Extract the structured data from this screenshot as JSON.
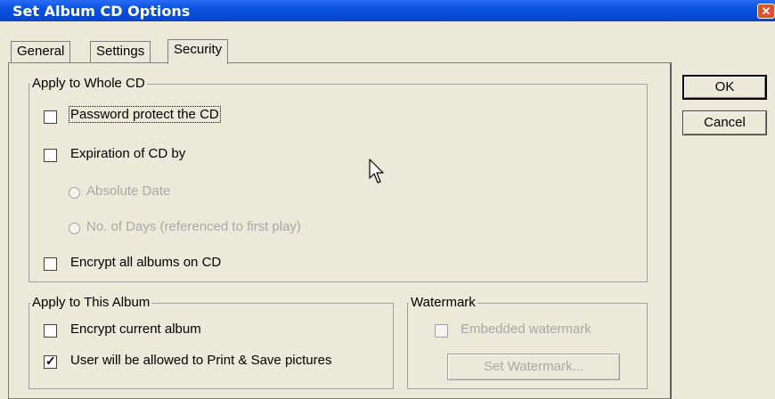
{
  "window": {
    "title": "Set Album CD Options",
    "close_label": "✕"
  },
  "tabs": [
    {
      "label": "General"
    },
    {
      "label": "Settings"
    },
    {
      "label": "Security",
      "active": true
    }
  ],
  "buttons": {
    "ok": "OK",
    "cancel": "Cancel"
  },
  "whole_cd": {
    "legend": "Apply to Whole CD",
    "password_label": "Password protect the CD",
    "password_checked": false,
    "expiration_label": "Expiration of CD by",
    "expiration_checked": false,
    "absolute_date_label": "Absolute Date",
    "days_label": "No. of Days (referenced to first play)",
    "encrypt_all_label": "Encrypt all albums on CD",
    "encrypt_all_checked": false
  },
  "this_album": {
    "legend": "Apply to This Album",
    "encrypt_current_label": "Encrypt current album",
    "encrypt_current_checked": false,
    "print_save_label": "User will be allowed to Print & Save pictures",
    "print_save_checked": true
  },
  "watermark": {
    "legend": "Watermark",
    "embedded_label": "Embedded watermark",
    "embedded_checked": false,
    "set_button": "Set Watermark..."
  },
  "colors": {
    "titlebar": "#0a52e0",
    "face": "#ece9d8",
    "disabled_text": "#a8a8a8"
  },
  "icons": {
    "close": "close-icon",
    "cursor": "mouse-pointer-icon"
  }
}
